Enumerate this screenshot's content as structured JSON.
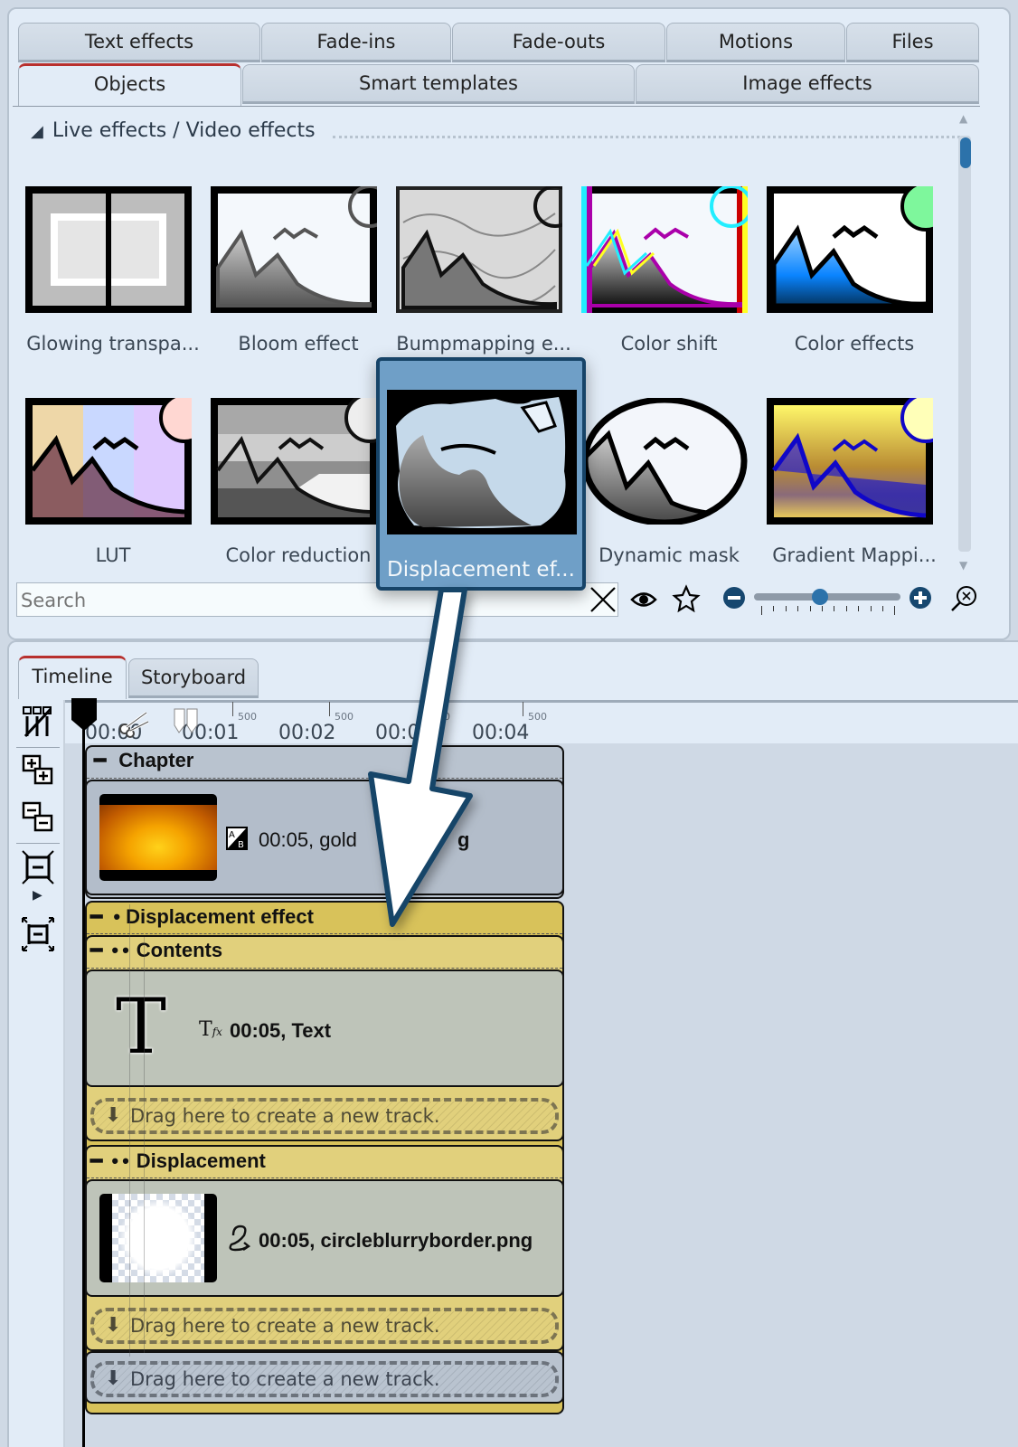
{
  "effects_panel": {
    "tabs_row1": [
      "Text effects",
      "Fade-ins",
      "Fade-outs",
      "Motions",
      "Files"
    ],
    "tabs_row2": [
      "Objects",
      "Smart templates",
      "Image effects"
    ],
    "active_tab": "Objects",
    "section_title": "Live effects / Video effects",
    "effects": [
      {
        "label": "Glowing transpa...",
        "icon": "glow-transparency-thumb"
      },
      {
        "label": "Bloom effect",
        "icon": "bloom-thumb"
      },
      {
        "label": "Bumpmapping e...",
        "icon": "bumpmapping-thumb"
      },
      {
        "label": "Color shift",
        "icon": "color-shift-thumb"
      },
      {
        "label": "Color effects",
        "icon": "color-effects-thumb"
      },
      {
        "label": "LUT",
        "icon": "lut-thumb"
      },
      {
        "label": "Color reduction",
        "icon": "color-reduction-thumb"
      },
      {
        "label": "Displacement ef...",
        "icon": "displacement-thumb"
      },
      {
        "label": "Dynamic mask",
        "icon": "dynamic-mask-thumb"
      },
      {
        "label": "Gradient Mappi...",
        "icon": "gradient-mapping-thumb"
      }
    ],
    "dragged_item": {
      "label": "Displacement ef..."
    },
    "search": {
      "placeholder": "Search",
      "value": ""
    },
    "toolbar": {
      "clear": "close-icon",
      "preview": "eye-icon",
      "favorite": "star-icon",
      "zoom_out": "minus-circle-icon",
      "zoom_in": "plus-circle-icon",
      "zoom_fit": "zoom-fit-icon"
    },
    "zoom_slider_value": 0.45
  },
  "timeline_panel": {
    "tabs": [
      "Timeline",
      "Storyboard"
    ],
    "active_tab": "Timeline",
    "ruler": {
      "major": [
        "00:00",
        "00:01",
        "00:02",
        "00:03",
        "00:04"
      ],
      "minor": "500"
    },
    "tools": [
      "show-tracks-icon",
      "expand-all-icon",
      "collapse-all-icon",
      "shrink-tracks-icon",
      "expand-tracks-icon"
    ],
    "tracks": {
      "chapter": {
        "title": "Chapter",
        "clip": "00:05, golden-bg.png",
        "clip_visible_prefix": "00:05, gold",
        "clip_visible_suffix": "g"
      },
      "effect_group": {
        "title": "Displacement effect"
      },
      "contents": {
        "title": "Contents",
        "clip": "00:05, Text"
      },
      "displacement": {
        "title": "Displacement",
        "clip": "00:05, circleblurryborder.png"
      },
      "drop_hint": "Drag here to create a new track."
    }
  },
  "colors": {
    "accent_tab": "#b8302e",
    "effect_group": "#d8c25a",
    "popup": "#6f9fc7",
    "arrow_outline": "#174468"
  }
}
